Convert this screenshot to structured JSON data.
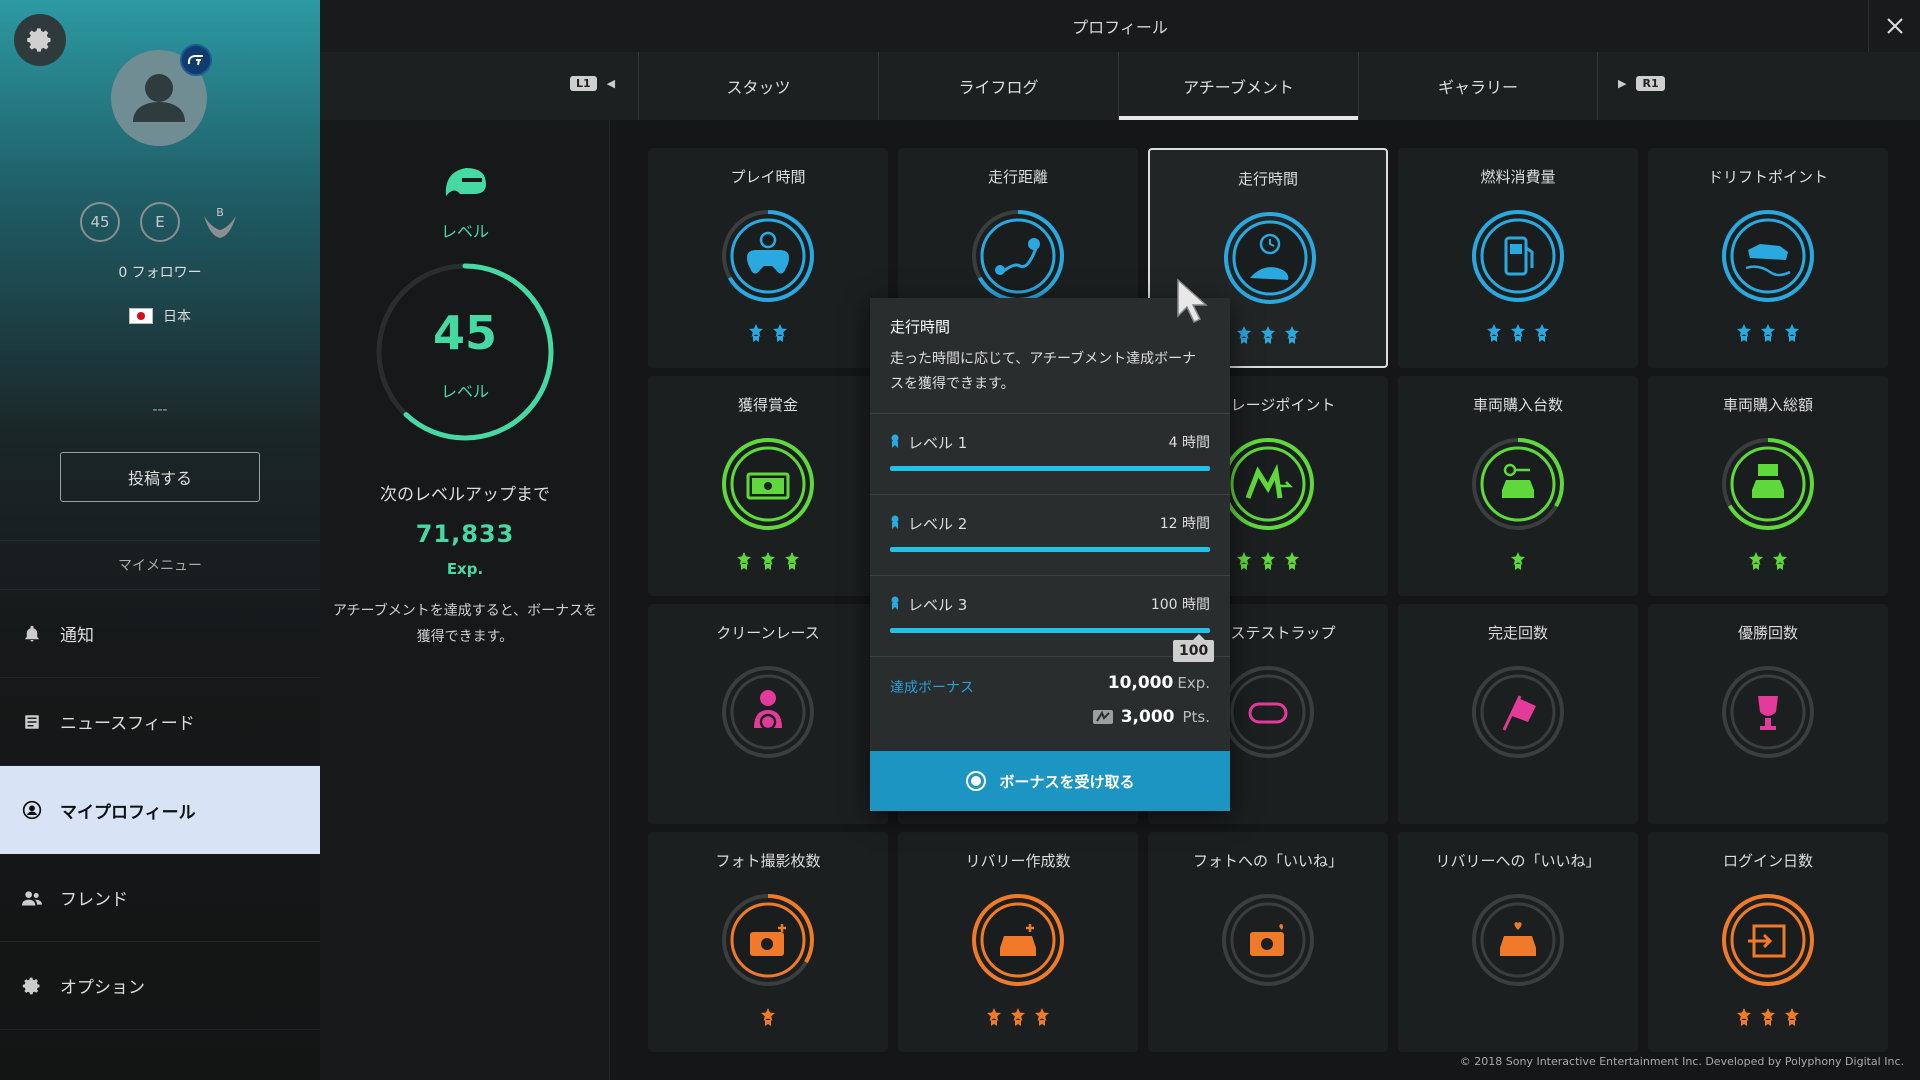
{
  "header": {
    "title": "プロフィール"
  },
  "tabs": {
    "left_button": "L1",
    "right_button": "R1",
    "items": [
      {
        "label": "スタッツ"
      },
      {
        "label": "ライフログ"
      },
      {
        "label": "アチーブメント",
        "active": true
      },
      {
        "label": "ギャラリー"
      }
    ]
  },
  "sidebar": {
    "badge_level": "45",
    "badge_rank": "E",
    "badge_wing": "B",
    "followers": "0 フォロワー",
    "country": "日本",
    "bio": "---",
    "post_button": "投稿する",
    "menu_title": "マイメニュー",
    "menu": [
      {
        "label": "通知",
        "icon": "bell-icon"
      },
      {
        "label": "ニュースフィード",
        "icon": "news-icon"
      },
      {
        "label": "マイプロフィール",
        "icon": "profile-icon",
        "active": true
      },
      {
        "label": "フレンド",
        "icon": "friends-icon"
      },
      {
        "label": "オプション",
        "icon": "gear-icon"
      }
    ]
  },
  "level": {
    "top_label": "レベル",
    "value": "45",
    "value_label": "レベル",
    "progress": 0.62,
    "next_label": "次のレベルアップまで",
    "next_exp": "71,833",
    "next_exp_unit": "Exp.",
    "description": "アチーブメントを達成すると、ボーナスを獲得できます。"
  },
  "achievements": [
    {
      "title": "プレイ時間",
      "stars": 2,
      "color": "#2aa8e0",
      "icon": "gamepad-icon"
    },
    {
      "title": "走行距離",
      "stars": 2,
      "color": "#2aa8e0",
      "icon": "route-icon"
    },
    {
      "title": "走行時間",
      "stars": 3,
      "color": "#2aa8e0",
      "icon": "road-clock-icon",
      "selected": true
    },
    {
      "title": "燃料消費量",
      "stars": 3,
      "color": "#2aa8e0",
      "icon": "fuel-icon"
    },
    {
      "title": "ドリフトポイント",
      "stars": 3,
      "color": "#2aa8e0",
      "icon": "drift-car-icon"
    },
    {
      "title": "獲得賞金",
      "stars": 3,
      "color": "#5ed83a",
      "icon": "money-icon"
    },
    {
      "title": "",
      "stars": 3,
      "color": "#5ed83a",
      "icon": "hidden-icon"
    },
    {
      "title": "マイレージポイント",
      "stars": 3,
      "color": "#5ed83a",
      "icon": "mileage-icon"
    },
    {
      "title": "車両購入台数",
      "stars": 1,
      "color": "#5ed83a",
      "icon": "car-key-icon"
    },
    {
      "title": "車両購入総額",
      "stars": 2,
      "color": "#5ed83a",
      "icon": "car-money-icon"
    },
    {
      "title": "クリーンレース",
      "stars": 0,
      "color": "#e43a9a",
      "icon": "driver-icon"
    },
    {
      "title": "",
      "stars": 0,
      "color": "#e43a9a",
      "icon": "hidden-icon"
    },
    {
      "title": "ファステストラップ",
      "stars": 0,
      "color": "#e43a9a",
      "icon": "lap-icon"
    },
    {
      "title": "完走回数",
      "stars": 0,
      "color": "#e43a9a",
      "icon": "checkered-flag-icon"
    },
    {
      "title": "優勝回数",
      "stars": 0,
      "color": "#e43a9a",
      "icon": "trophy-icon"
    },
    {
      "title": "フォト撮影枚数",
      "stars": 1,
      "color": "#f07a2a",
      "icon": "camera-icon"
    },
    {
      "title": "リバリー作成数",
      "stars": 3,
      "color": "#f07a2a",
      "icon": "livery-car-icon"
    },
    {
      "title": "フォトへの「いいね」",
      "stars": 0,
      "color": "#f07a2a",
      "icon": "camera-heart-icon"
    },
    {
      "title": "リバリーへの「いいね」",
      "stars": 0,
      "color": "#f07a2a",
      "icon": "car-heart-icon"
    },
    {
      "title": "ログイン日数",
      "stars": 3,
      "color": "#f07a2a",
      "icon": "login-icon"
    }
  ],
  "tooltip": {
    "title": "走行時間",
    "description": "走った時間に応じて、アチーブメント達成ボーナスを獲得できます。",
    "levels": [
      {
        "label": "レベル 1",
        "value": "4 時間",
        "progress": 1.0
      },
      {
        "label": "レベル 2",
        "value": "12 時間",
        "progress": 1.0
      },
      {
        "label": "レベル 3",
        "value": "100 時間",
        "progress": 1.0
      }
    ],
    "bubble": "100",
    "bonus_label": "達成ボーナス",
    "bonus_exp": "10,000",
    "bonus_exp_unit": "Exp.",
    "bonus_pts": "3,000",
    "bonus_pts_unit": "Pts.",
    "claim_button": "ボーナスを受け取る"
  },
  "footer": {
    "copyright": "© 2018 Sony Interactive Entertainment Inc. Developed by Polyphony Digital Inc."
  }
}
